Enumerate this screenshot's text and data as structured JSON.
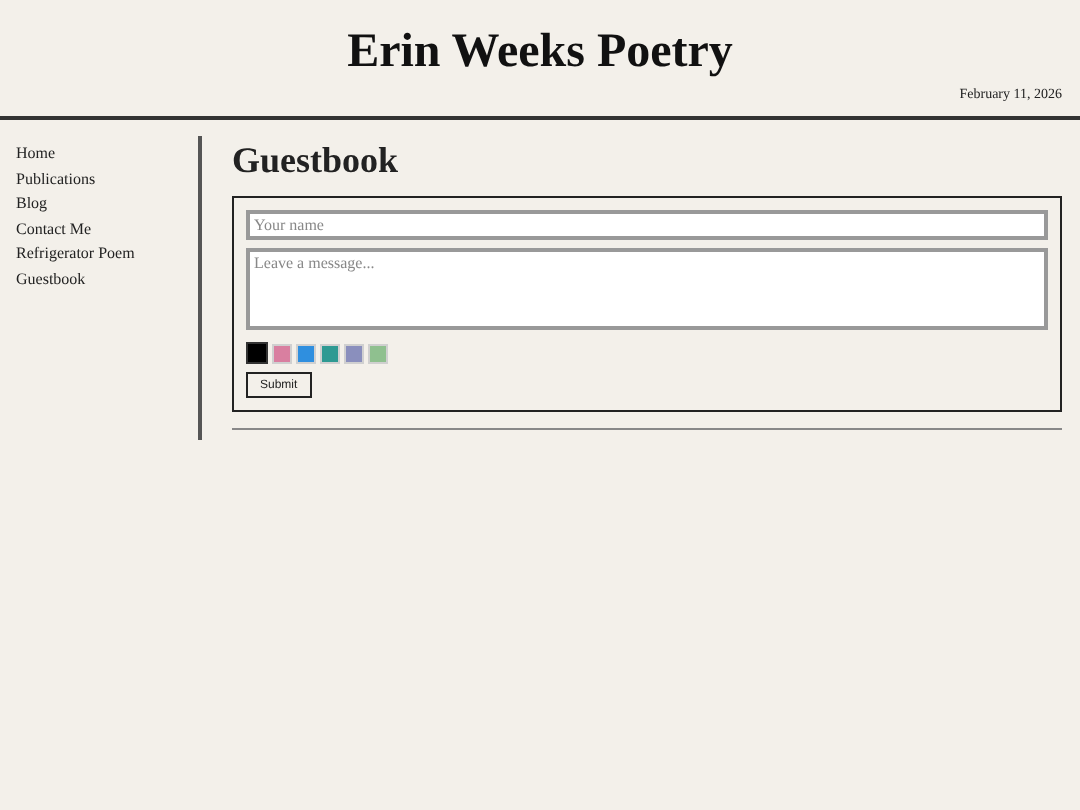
{
  "header": {
    "title": "Erin Weeks Poetry",
    "date": "February 11, 2026"
  },
  "nav": [
    "Home",
    "Publications",
    "Blog",
    "Contact Me",
    "Refrigerator Poem",
    "Guestbook"
  ],
  "page": {
    "heading": "Guestbook"
  },
  "form": {
    "name_placeholder": "Your name",
    "message_placeholder": "Leave a message...",
    "swatches": [
      {
        "color": "#000000",
        "selected": true
      },
      {
        "color": "#d97fa0",
        "selected": false
      },
      {
        "color": "#2f8fdf",
        "selected": false
      },
      {
        "color": "#2e9a93",
        "selected": false
      },
      {
        "color": "#8a8fbd",
        "selected": false
      },
      {
        "color": "#8fc08f",
        "selected": false
      }
    ],
    "submit": "Submit"
  }
}
